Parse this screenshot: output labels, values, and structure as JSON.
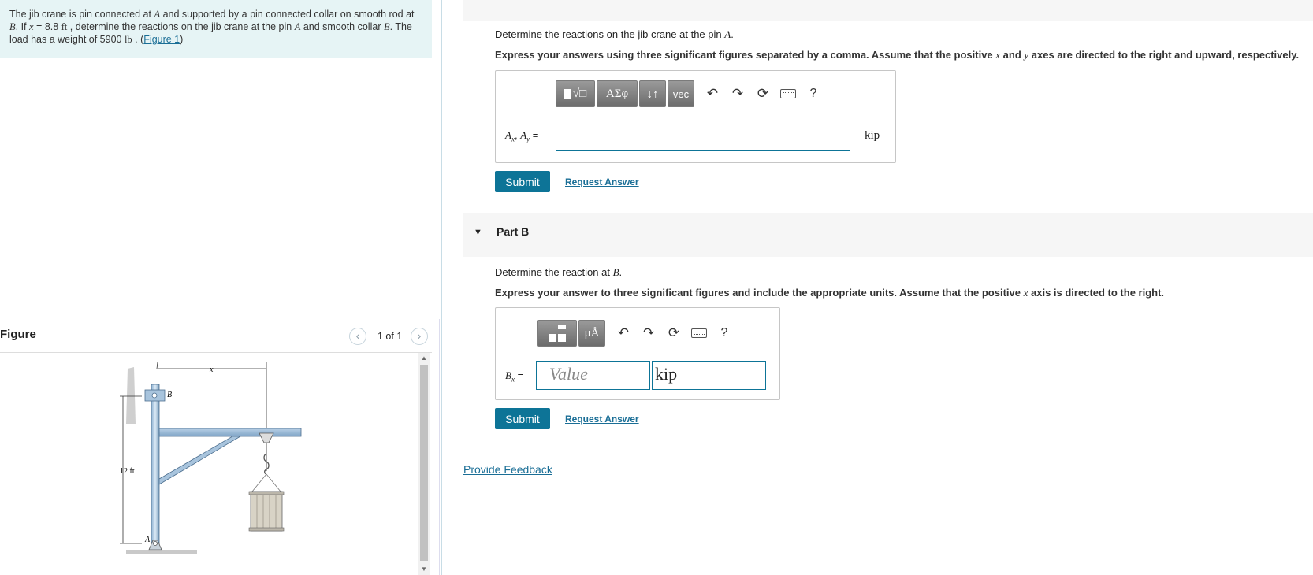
{
  "problem": {
    "seg1": "The jib crane is pin connected at ",
    "A": "A",
    "seg2": " and supported by a pin connected collar on smooth rod at ",
    "B": "B",
    "seg3": ". If ",
    "x": "x",
    "seg4": " = 8.8 ",
    "ft": "ft",
    "seg5": " , determine the reactions on the jib crane at the pin ",
    "A2": "A",
    "seg6": " and smooth collar ",
    "B2": "B",
    "seg7": ". The load has a weight of 5900 ",
    "lb": "lb",
    "seg8": " . (",
    "figure_link": "Figure 1",
    "seg9": ")"
  },
  "figure": {
    "title": "Figure",
    "counter": "1 of 1",
    "labels": {
      "x": "x",
      "B": "B",
      "A": "A",
      "height": "12 ft"
    }
  },
  "partA": {
    "question_pre": "Determine the reactions on the jib crane at the pin ",
    "question_var": "A",
    "question_post": ".",
    "instr_pre": "Express your answers using three significant figures separated by a comma. Assume that the positive ",
    "instr_x": "x",
    "instr_mid": " and ",
    "instr_y": "y",
    "instr_post": " axes are directed to the right and upward, respectively.",
    "toolbar": {
      "greek": "ΑΣφ",
      "arrows": "↓↑",
      "vec": "vec",
      "help": "?"
    },
    "label_A1": "A",
    "label_x": "x",
    "label_sep": ", ",
    "label_A2": "A",
    "label_y": "y",
    "label_eq": " =",
    "unit": "kip",
    "submit": "Submit",
    "request": "Request Answer"
  },
  "partB": {
    "title": "Part B",
    "question_pre": "Determine the reaction at ",
    "question_var": "B",
    "question_post": ".",
    "instr_pre": "Express your answer to three significant figures and include the appropriate units. Assume that the positive ",
    "instr_x": "x",
    "instr_post": " axis is directed to the right.",
    "toolbar": {
      "mu": "μÅ",
      "help": "?"
    },
    "label_B": "B",
    "label_x": "x",
    "label_eq": " =",
    "value_placeholder": "Value",
    "unit_value": "kip",
    "submit": "Submit",
    "request": "Request Answer"
  },
  "feedback": "Provide Feedback"
}
